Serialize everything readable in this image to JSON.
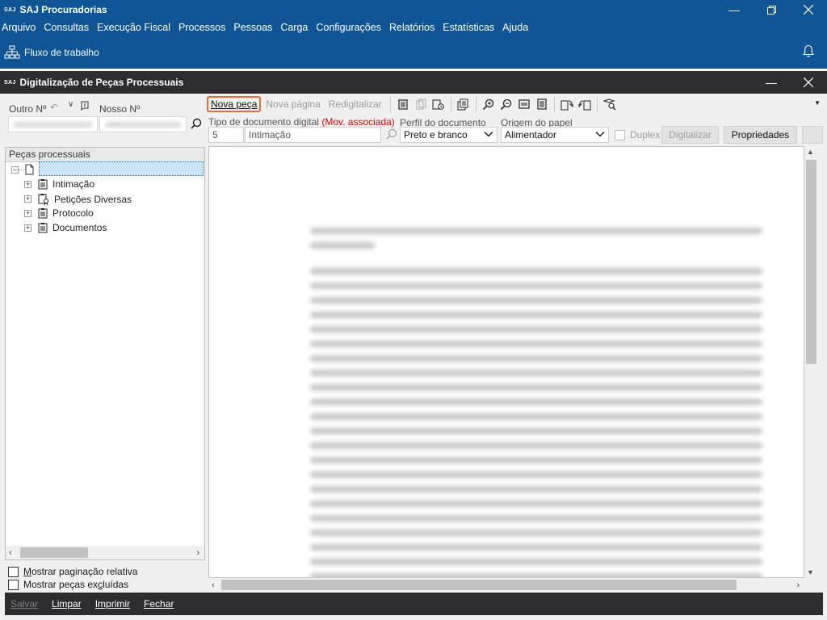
{
  "app": {
    "logo": "SAJ",
    "title": "SAJ Procuradorias"
  },
  "menu": [
    "Arquivo",
    "Consultas",
    "Execução Fiscal",
    "Processos",
    "Pessoas",
    "Carga",
    "Configurações",
    "Relatórios",
    "Estatísticas",
    "Ajuda"
  ],
  "toolbar_top": {
    "workflow_label": "Fluxo de trabalho"
  },
  "window": {
    "title": "Digitalização de Peças Processuais"
  },
  "search": {
    "outro_label": "Outro Nº",
    "nosso_label": "Nosso Nº"
  },
  "tree": {
    "header": "Peças processuais",
    "items": [
      "Intimação",
      "Petições Diversas",
      "Protocolo",
      "Documentos"
    ]
  },
  "options": {
    "paginacao_prefix": "M",
    "paginacao_rest": "ostrar paginação relativa",
    "excluidas_before": "Mostrar peças ex",
    "excluidas_underlined": "c",
    "excluidas_after": "luídas"
  },
  "actions": {
    "nova_peca": "Nova peça",
    "nova_pagina": "Nova página",
    "redigitalizar": "Redigitalizar"
  },
  "form": {
    "tipo_label": "Tipo de documento digital",
    "mov_associada": "(Mov. associada)",
    "perfil_label": "Perfil do documento",
    "origem_label": "Origem do papel",
    "tipo_code": "5",
    "tipo_name": "Intimação",
    "perfil_value": "Preto e branco",
    "origem_value": "Alimentador",
    "duplex_label": "Duplex",
    "digitalizar": "Digitalizar",
    "propriedades": "Propriedades"
  },
  "footer": {
    "salvar": "Salvar",
    "limpar": "Limpar",
    "imprimir": "Imprimir",
    "fechar": "Fechar"
  },
  "colors": {
    "brand": "#0f5596",
    "dark_bar": "#2d2d30",
    "highlight": "#ee6a32",
    "alert_text": "#e00000"
  }
}
